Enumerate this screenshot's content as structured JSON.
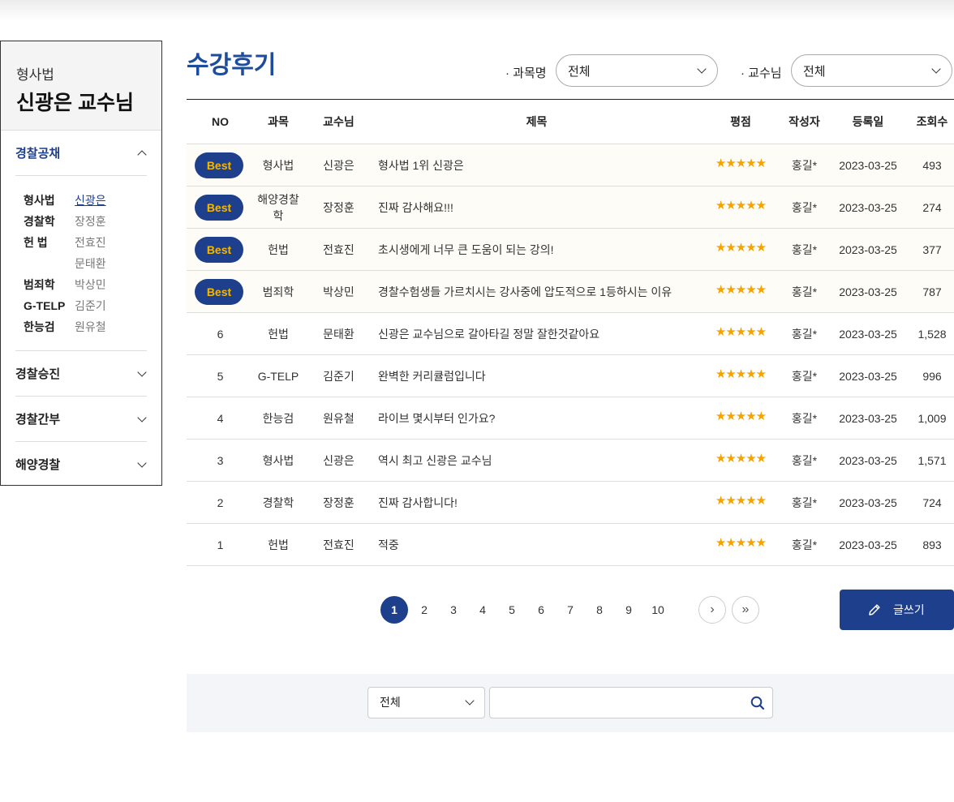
{
  "sidebar": {
    "subject": "형사법",
    "title": "신광은 교수님",
    "categories": [
      {
        "label": "경찰공채",
        "open": true
      },
      {
        "label": "경찰승진"
      },
      {
        "label": "경찰간부"
      },
      {
        "label": "해양경찰"
      }
    ],
    "professors": [
      {
        "subject": "형사법",
        "name": "신광은",
        "active": true
      },
      {
        "subject": "경찰학",
        "name": "장정훈"
      },
      {
        "subject": "헌 법",
        "name": "전효진"
      },
      {
        "subject": "",
        "name": "문태환"
      },
      {
        "subject": "범죄학",
        "name": "박상민"
      },
      {
        "subject": "G-TELP",
        "name": "김준기"
      },
      {
        "subject": "한능검",
        "name": "원유철"
      }
    ]
  },
  "main": {
    "title": "수강후기",
    "filters": {
      "subject_label": "· 과목명",
      "subject_value": "전체",
      "professor_label": "· 교수님",
      "professor_value": "전체"
    }
  },
  "table": {
    "headers": {
      "no": "NO",
      "subject": "과목",
      "professor": "교수님",
      "title": "제목",
      "rating": "평점",
      "writer": "작성자",
      "date": "등록일",
      "views": "조회수"
    },
    "best_label": "Best",
    "stars": "★★★★★",
    "rows": [
      {
        "no": "",
        "best": true,
        "subject": "형사법",
        "professor": "신광은",
        "title": "형사법 1위 신광은",
        "writer": "홍길*",
        "date": "2023-03-25",
        "views": "493"
      },
      {
        "no": "",
        "best": true,
        "subject": "해양경찰학",
        "professor": "장정훈",
        "title": "진짜 감사해요!!!",
        "writer": "홍길*",
        "date": "2023-03-25",
        "views": "274"
      },
      {
        "no": "",
        "best": true,
        "subject": "헌법",
        "professor": "전효진",
        "title": "초시생에게 너무 큰 도움이 되는 강의!",
        "writer": "홍길*",
        "date": "2023-03-25",
        "views": "377"
      },
      {
        "no": "",
        "best": true,
        "subject": "범죄학",
        "professor": "박상민",
        "title": "경찰수험생들 가르치시는 강사중에 압도적으로 1등하시는 이유",
        "writer": "홍길*",
        "date": "2023-03-25",
        "views": "787"
      },
      {
        "no": "6",
        "best": false,
        "subject": "헌법",
        "professor": "문태환",
        "title": "신광은 교수님으로 갈아타길 정말 잘한것같아요",
        "writer": "홍길*",
        "date": "2023-03-25",
        "views": "1,528"
      },
      {
        "no": "5",
        "best": false,
        "subject": "G-TELP",
        "professor": "김준기",
        "title": "완벽한 커리큘럼입니다",
        "writer": "홍길*",
        "date": "2023-03-25",
        "views": "996"
      },
      {
        "no": "4",
        "best": false,
        "subject": "한능검",
        "professor": "원유철",
        "title": "라이브 몇시부터 인가요?",
        "writer": "홍길*",
        "date": "2023-03-25",
        "views": "1,009"
      },
      {
        "no": "3",
        "best": false,
        "subject": "형사법",
        "professor": "신광은",
        "title": "역시 최고 신광은 교수님",
        "writer": "홍길*",
        "date": "2023-03-25",
        "views": "1,571"
      },
      {
        "no": "2",
        "best": false,
        "subject": "경찰학",
        "professor": "장정훈",
        "title": "진짜 감사합니다!",
        "writer": "홍길*",
        "date": "2023-03-25",
        "views": "724"
      },
      {
        "no": "1",
        "best": false,
        "subject": "헌법",
        "professor": "전효진",
        "title": "적중",
        "writer": "홍길*",
        "date": "2023-03-25",
        "views": "893"
      }
    ]
  },
  "pagination": {
    "pages": [
      "1",
      "2",
      "3",
      "4",
      "5",
      "6",
      "7",
      "8",
      "9",
      "10"
    ],
    "current": "1",
    "next_icon": "chevron-right-icon",
    "last_icon": "double-chevron-right-icon",
    "next_glyph": "›",
    "last_glyph": "»"
  },
  "write_button": {
    "label": "글쓰기",
    "icon": "pencil-icon"
  },
  "search": {
    "select_value": "전체",
    "input_value": "",
    "icon": "search-icon"
  },
  "colors": {
    "primary": "#1e3f8c",
    "title": "#1e4c9c",
    "best_text": "#f5b800",
    "star": "#f5a300"
  }
}
